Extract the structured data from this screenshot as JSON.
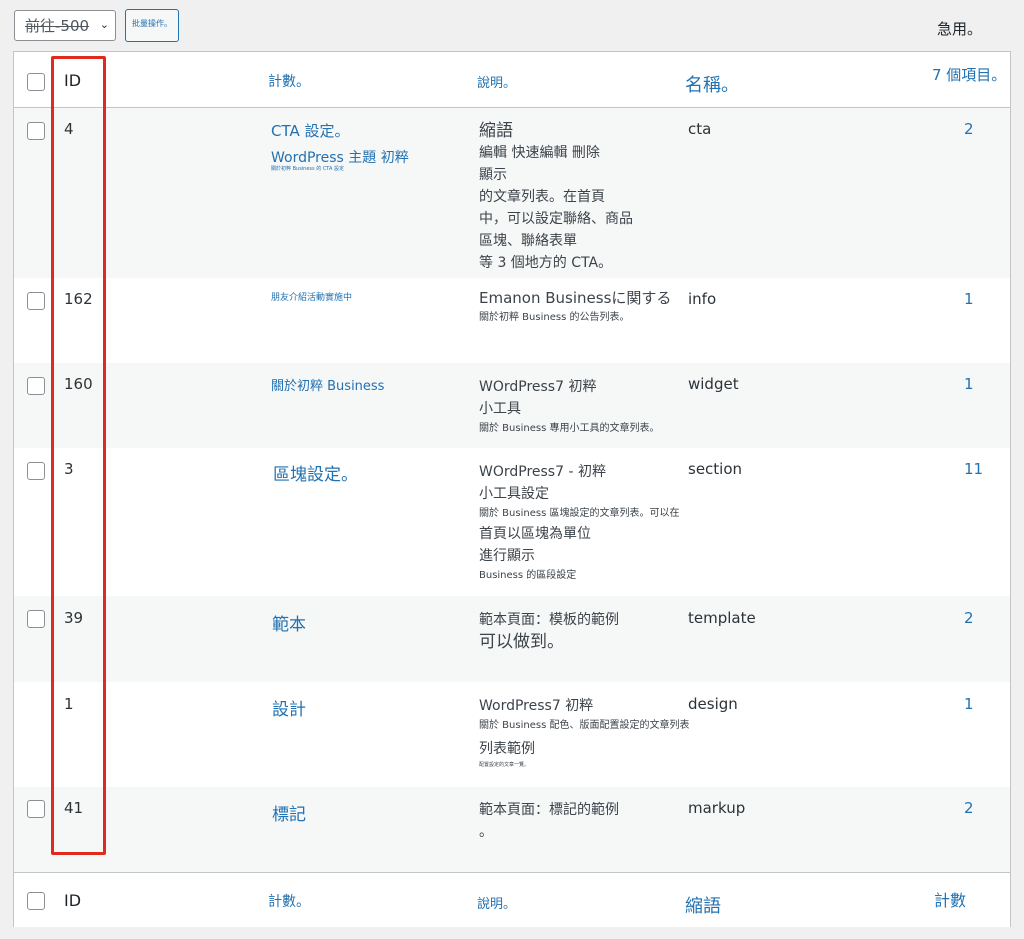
{
  "toolbar": {
    "bulk_select_value": "前往-500",
    "apply_label": "批量操作。",
    "right_text": "急用。"
  },
  "header": {
    "id": "ID",
    "name": "計數。",
    "description": "說明。",
    "slug": "名稱。",
    "count": "7 個項目。"
  },
  "rows": [
    {
      "id": "4",
      "name": "CTA 設定。",
      "name_sub": "WordPress 主題 初粹",
      "name_tiny": "關於初粹 Business 的 CTA 設定",
      "desc_lines": [
        "縮語",
        "編輯 快速編輯 刪除",
        "顯示",
        "的文章列表。在首頁",
        "中，可以設定聯絡、商品",
        "區塊、聯絡表單",
        "等 3 個地方的 CTA。"
      ],
      "slug": "cta",
      "count": "2"
    },
    {
      "id": "162",
      "name": "朋友介紹活動實施中",
      "desc_lines": [
        "Emanon Businessに関する"
      ],
      "desc_small": "關於初粹 Business 的公告列表。",
      "slug": "info",
      "count": "1"
    },
    {
      "id": "160",
      "name": "關於初粹 Business",
      "desc_lines": [
        "WOrdPress7 初粹",
        "小工具"
      ],
      "desc_small": "關於 Business 專用小工具的文章列表。",
      "slug": "widget",
      "count": "1"
    },
    {
      "id": "3",
      "name": "區塊設定。",
      "desc_lines": [
        "WOrdPress7 - 初粹",
        "小工具設定"
      ],
      "desc_small": "關於 Business 區塊設定的文章列表。可以在",
      "desc_lines2": [
        "首頁以區塊為單位",
        "進行顯示"
      ],
      "desc_small2": "Business 的區段設定",
      "slug": "section",
      "count": "11"
    },
    {
      "id": "39",
      "name": "範本",
      "desc_lines": [
        "範本頁面：模板的範例"
      ],
      "desc_big": "可以做到。",
      "slug": "template",
      "count": "2"
    },
    {
      "id": "1",
      "name": "設計",
      "desc_lines": [
        "WordPress7 初粹"
      ],
      "desc_small": "關於 Business 配色、版面配置設定的文章列表",
      "desc_lines2": [
        "列表範例"
      ],
      "desc_tiny": "配置設定的文章一覽。",
      "slug": "design",
      "count": "1"
    },
    {
      "id": "41",
      "name": "標記",
      "desc_lines": [
        "範本頁面：標記的範例",
        "。"
      ],
      "slug": "markup",
      "count": "2"
    }
  ],
  "footer": {
    "id": "ID",
    "name": "計數。",
    "description": "說明。",
    "slug": "縮語",
    "count": "計數"
  },
  "colors": {
    "link": "#2271b1",
    "highlight": "#e02a1e",
    "alt_row": "#f6f7f7"
  }
}
